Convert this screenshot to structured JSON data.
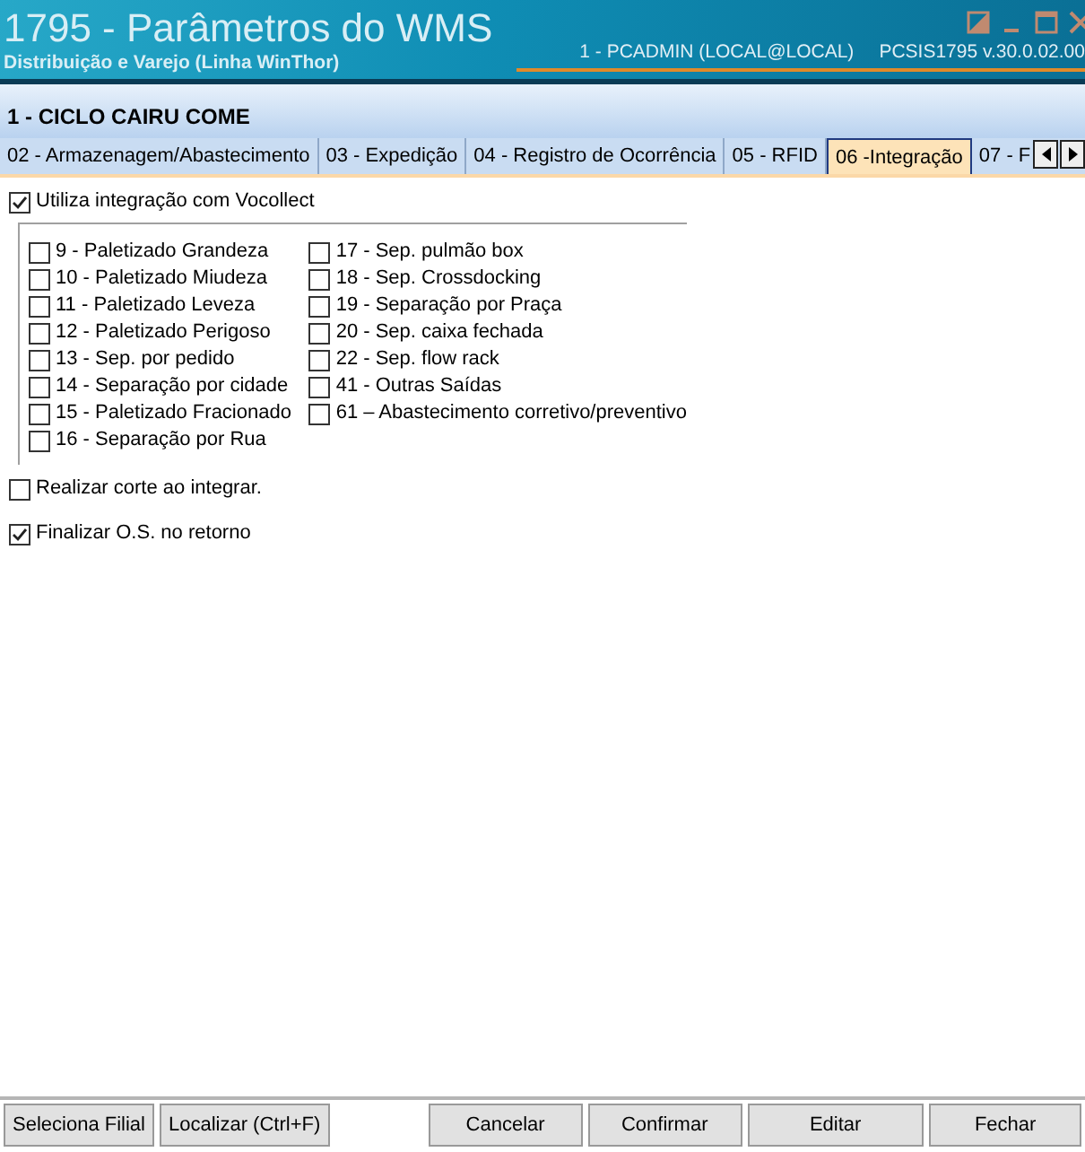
{
  "window": {
    "title": "1795 - Parâmetros do WMS",
    "subtitle": "Distribuição e Varejo (Linha WinThor)",
    "user": "1 - PCADMIN (LOCAL@LOCAL)",
    "version": "PCSIS1795  v.30.0.02.00"
  },
  "header": "1 - CICLO CAIRU COME",
  "tabs": [
    {
      "label": "02 - Armazenagem/Abastecimento",
      "selected": false
    },
    {
      "label": "03 - Expedição",
      "selected": false
    },
    {
      "label": "04 - Registro de Ocorrência",
      "selected": false
    },
    {
      "label": "05 - RFID",
      "selected": false
    },
    {
      "label": "06 -Integração",
      "selected": true
    },
    {
      "label": "07 - F",
      "selected": false
    }
  ],
  "vocollect": {
    "label": "Utiliza integração com Vocollect",
    "checked": true
  },
  "options_columns": [
    [
      {
        "label": "9 - Paletizado Grandeza",
        "checked": false
      },
      {
        "label": "10 - Paletizado Miudeza",
        "checked": false
      },
      {
        "label": "11 - Paletizado Leveza",
        "checked": false
      },
      {
        "label": "12 - Paletizado Perigoso",
        "checked": false
      },
      {
        "label": "13 - Sep. por pedido",
        "checked": false
      },
      {
        "label": "14 - Separação por cidade",
        "checked": false
      },
      {
        "label": "15 - Paletizado Fracionado",
        "checked": false
      },
      {
        "label": "16 - Separação por Rua",
        "checked": false
      }
    ],
    [
      {
        "label": "17 - Sep. pulmão box",
        "checked": false
      },
      {
        "label": "18 - Sep. Crossdocking",
        "checked": false
      },
      {
        "label": "19 - Separação por Praça",
        "checked": false
      },
      {
        "label": "20 - Sep. caixa fechada",
        "checked": false
      },
      {
        "label": "22 - Sep. flow rack",
        "checked": false
      },
      {
        "label": "41 - Outras Saídas",
        "checked": false
      },
      {
        "label": "61 – Abastecimento corretivo/preventivo",
        "checked": false
      }
    ]
  ],
  "realizar_corte": {
    "label": "Realizar corte ao integrar.",
    "checked": false
  },
  "finalizar_os": {
    "label": "Finalizar O.S. no retorno",
    "checked": true
  },
  "left_buttons": [
    "Seleciona Filial",
    "Localizar (Ctrl+F)"
  ],
  "right_buttons": [
    "Cancelar",
    "Confirmar",
    "Editar",
    "Fechar"
  ]
}
